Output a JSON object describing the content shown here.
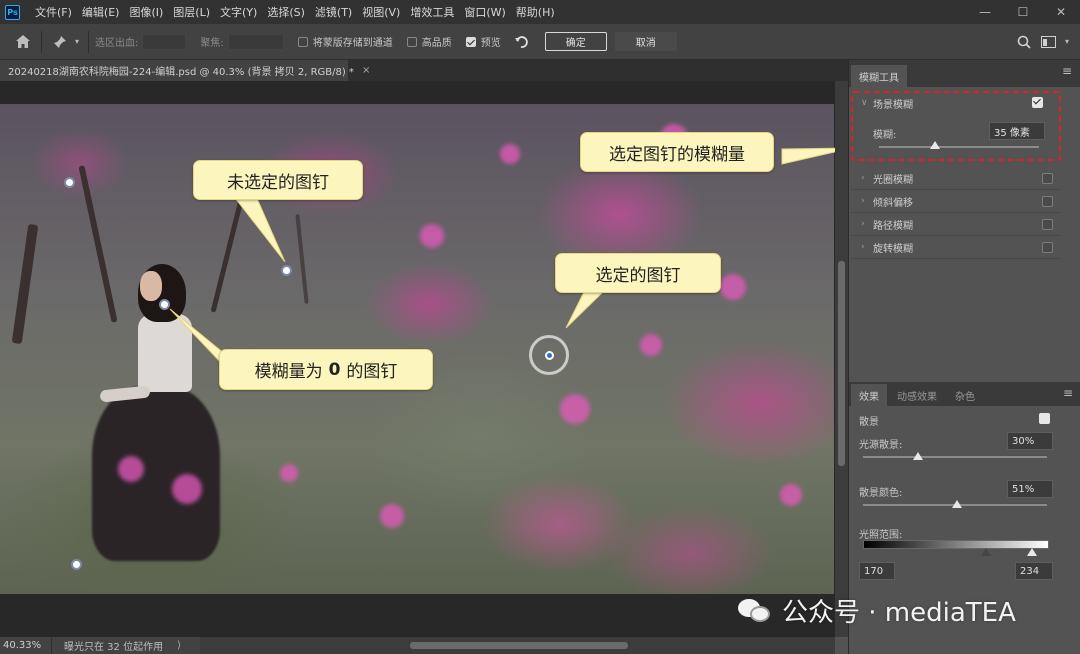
{
  "menubar": {
    "logo": "Ps",
    "items": [
      "文件(F)",
      "编辑(E)",
      "图像(I)",
      "图层(L)",
      "文字(Y)",
      "选择(S)",
      "滤镜(T)",
      "视图(V)",
      "增效工具",
      "窗口(W)",
      "帮助(H)"
    ],
    "win_minimize": "—",
    "win_maximize": "☐",
    "win_close": "✕"
  },
  "options": {
    "selection_bleed_label": "选区出血:",
    "focus_label": "聚焦:",
    "save_mask_label": "将蒙版存储到通道",
    "save_mask_checked": false,
    "high_quality_label": "高品质",
    "high_quality_checked": false,
    "preview_label": "预览",
    "preview_checked": true,
    "ok_label": "确定",
    "cancel_label": "取消"
  },
  "document": {
    "tab_title": "20240218湖南农科院梅园-224-编辑.psd @ 40.3% (背景 拷贝 2, RGB/8) *",
    "tab_close": "×"
  },
  "canvas": {
    "callouts": {
      "unselected_pin": "未选定的图钉",
      "selected_pin_amount": "选定图钉的模糊量",
      "selected_pin": "选定的图钉",
      "zero_blur_pin_prefix": "模糊量为",
      "zero_blur_pin_value": "0",
      "zero_blur_pin_suffix": "的图钉"
    }
  },
  "statusbar": {
    "zoom": "40.33%",
    "message": "曝光只在 32 位起作用",
    "arrow": "⟩"
  },
  "blur_tools_panel": {
    "tab_label": "模糊工具",
    "menu_icon": "≡",
    "field_blur": {
      "label": "场景模糊",
      "enabled": true,
      "blur_label": "模糊:",
      "blur_value": "35 像素",
      "blur_slider": 0.35
    },
    "others": [
      {
        "label": "光圈模糊",
        "enabled": false
      },
      {
        "label": "倾斜偏移",
        "enabled": false
      },
      {
        "label": "路径模糊",
        "enabled": false
      },
      {
        "label": "旋转模糊",
        "enabled": false
      }
    ]
  },
  "effects_panel": {
    "tabs": [
      "效果",
      "动感效果",
      "杂色"
    ],
    "menu_icon": "≡",
    "bokeh_label": "散景",
    "bokeh_enabled": true,
    "light_bokeh_label": "光源散景:",
    "light_bokeh_value": "30%",
    "light_bokeh_slider": 0.3,
    "bokeh_color_label": "散景颜色:",
    "bokeh_color_value": "51%",
    "bokeh_color_slider": 0.51,
    "light_range_label": "光照范围:",
    "light_range_low": "170",
    "light_range_high": "234"
  },
  "watermark": {
    "text": "公众号 · mediaTEA"
  }
}
